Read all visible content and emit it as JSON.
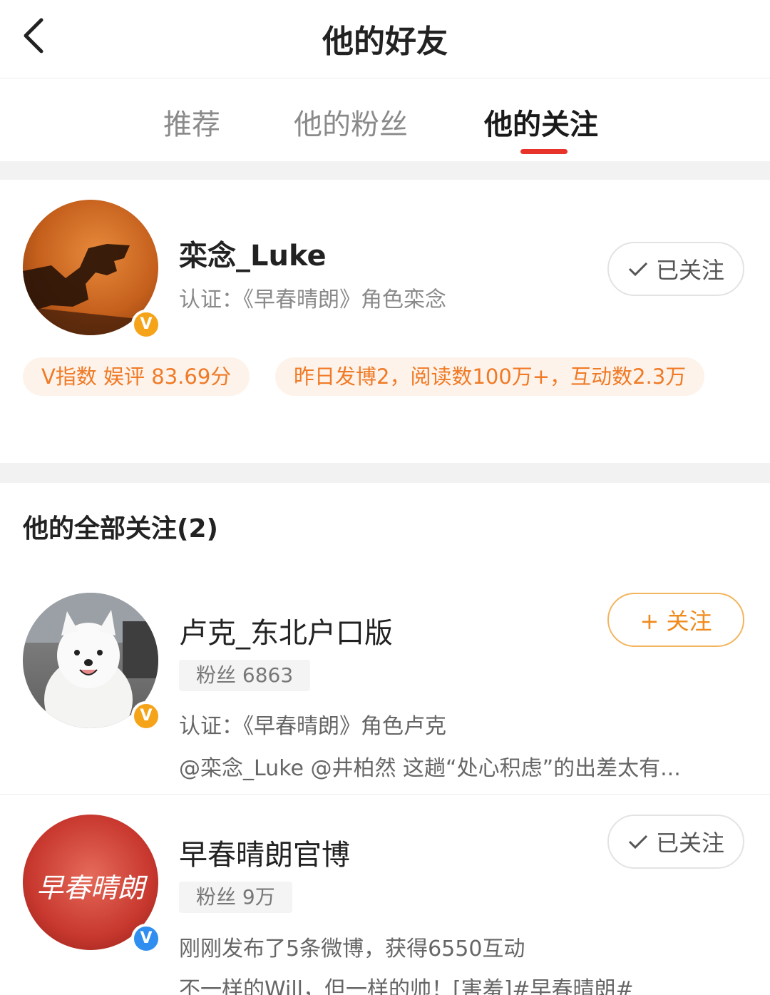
{
  "header": {
    "title": "他的好友",
    "back_icon": "chevron-left-icon"
  },
  "tabs": [
    {
      "label": "推荐",
      "active": false
    },
    {
      "label": "他的粉丝",
      "active": false
    },
    {
      "label": "他的关注",
      "active": true
    }
  ],
  "profile": {
    "name": "栾念_Luke",
    "verification": "认证：《早春晴朗》角色栾念",
    "badge": "V",
    "badge_color": "#f5a41a",
    "follow_status": "已关注",
    "stats": [
      "V指数 娱评 83.69分",
      "昨日发博2，阅读数100万+，互动数2.3万"
    ]
  },
  "following": {
    "title": "他的全部关注(2)",
    "items": [
      {
        "name": "卢克_东北户口版",
        "fans": "粉丝 6863",
        "verification": "认证：《早春晴朗》角色卢克",
        "latest": "@栾念_Luke @井柏然 这趟“处心积虑”的出差太有...",
        "badge": "V",
        "badge_color": "#f5a41a",
        "follow_status": "+ 关注"
      },
      {
        "name": "早春晴朗官博",
        "fans": "粉丝 9万",
        "activity": "刚刚发布了5条微博，获得6550互动",
        "latest": "不一样的Will，但一样的帅！[害羞]#早春晴朗#",
        "avatar_text": "早春晴朗",
        "badge": "V",
        "badge_color": "#2f8ef0",
        "follow_status": "已关注"
      }
    ]
  },
  "colors": {
    "accent_red": "#e8332a",
    "accent_orange": "#f08a1c",
    "pill_bg": "#fdf3ea"
  }
}
